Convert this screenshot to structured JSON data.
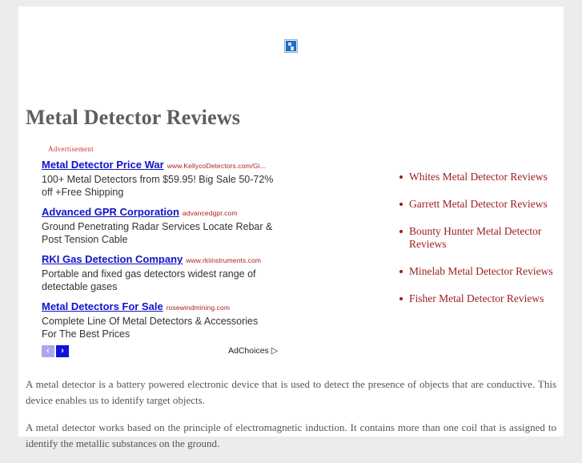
{
  "page": {
    "title": "Metal Detector Reviews",
    "top_image_icon": "broken-image-icon"
  },
  "ad_block": {
    "label": "Advertisement",
    "ads": [
      {
        "title": "Metal Detector Price War",
        "url": "www.KellycoDetectors.com/Gi...",
        "description": "100+ Metal Detectors from $59.95! Big Sale 50-72% off +Free Shipping"
      },
      {
        "title": "Advanced GPR Corporation",
        "url": "advancedgpr.com",
        "description": "Ground Penetrating Radar Services Locate Rebar & Post Tension Cable"
      },
      {
        "title": "RKI Gas Detection Company",
        "url": "www.rkiinstruments.com",
        "description": "Portable and fixed gas detectors widest range of detectable gases"
      },
      {
        "title": "Metal Detectors For Sale",
        "url": "rosewindmining.com",
        "description": "Complete Line Of Metal Detectors & Accessories For The Best Prices"
      }
    ],
    "nav": {
      "prev_label": "‹",
      "next_label": "›",
      "prev_icon": "chevron-left-icon",
      "next_icon": "chevron-right-icon",
      "prev_color": "#a8a8f0",
      "next_color": "#1111dd"
    },
    "adchoices": {
      "label": "AdChoices",
      "icon": "adchoices-triangle-icon",
      "glyph": "▷"
    }
  },
  "related_links": [
    "Whites Metal Detector Reviews",
    "Garrett Metal Detector Reviews",
    "Bounty Hunter Metal Detector Reviews",
    "Minelab Metal Detector Reviews",
    "Fisher Metal Detector Reviews"
  ],
  "body": {
    "paragraph_1": "A metal detector is a battery powered electronic device that is used to detect the presence of objects that are conductive. This device enables us to identify target objects.",
    "paragraph_2": "A metal detector works based on the principle of electromagnetic induction. It contains more than one coil that is assigned to identify the metallic substances on the ground."
  },
  "colors": {
    "page_background": "#ececec",
    "content_background": "#ffffff",
    "title": "#5e5e5e",
    "ad_title_link": "#1111cc",
    "ad_url": "#aa2222",
    "ad_label": "#cc3333",
    "related_link": "#9e1b1b",
    "body_text": "#555555"
  }
}
